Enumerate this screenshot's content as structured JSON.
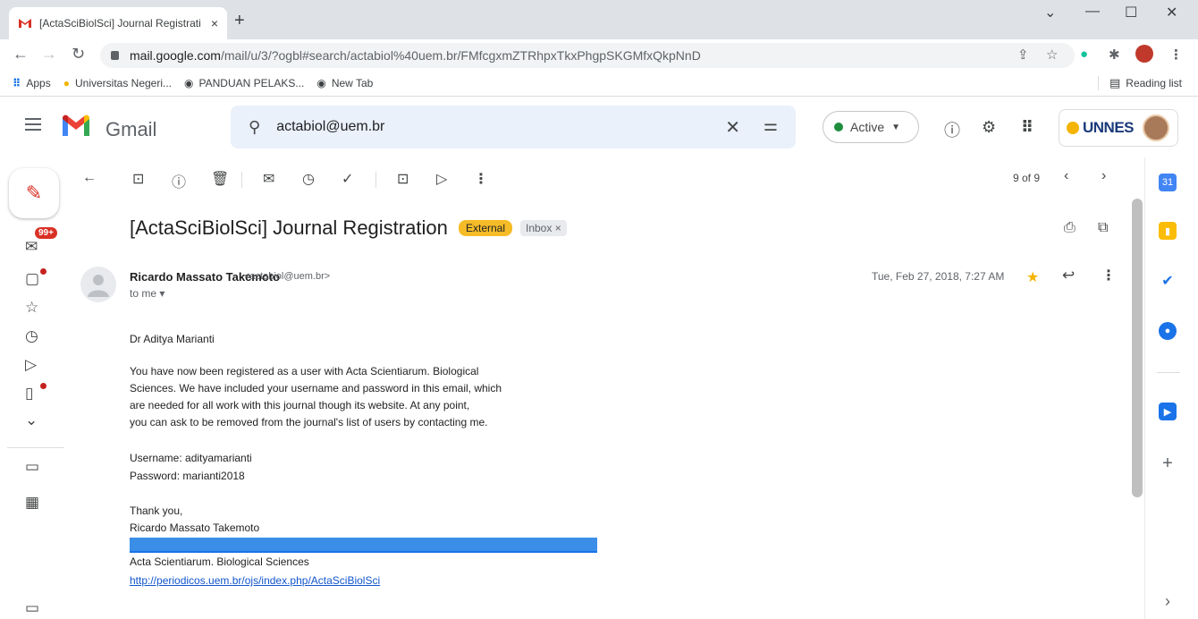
{
  "browser": {
    "tab_title": "[ActaSciBiolSci] Journal Registrati",
    "tab_close": "×",
    "new_tab": "+",
    "url_host": "mail.google.com",
    "url_rest": "/mail/u/3/?ogbl#search/actabiol%40uem.br/FMfcgxmZTRhpxTkxPhgpSKGMfxQkpNnD",
    "bookmarks": [
      {
        "label": "Apps"
      },
      {
        "label": "Universitas Negeri..."
      },
      {
        "label": "PANDUAN PELAKS..."
      },
      {
        "label": "New Tab"
      }
    ],
    "reading_list": "Reading list"
  },
  "gmail": {
    "app_name": "Gmail",
    "search_value": "actabiol@uem.br",
    "status_label": "Active",
    "account_logo_text": "UNNES",
    "unread_badge": "99+",
    "pager": "9 of 9"
  },
  "message": {
    "subject": "[ActaSciBiolSci] Journal Registration",
    "label_external": "External",
    "label_inbox": "Inbox ×",
    "sender_name": "Ricardo Massato Takemoto",
    "sender_email": "<actabiol@uem.br>",
    "to": "to me ▾",
    "date": "Tue, Feb 27, 2018, 7:27 AM",
    "greeting": "Dr Aditya Marianti",
    "para_line1": "You have now been registered as a user with Acta Scientiarum. Biological",
    "para_line2": "Sciences. We have included your username and password in this email, which",
    "para_line3": "are needed for all work with this journal though its website. At any point,",
    "para_line4": "you can ask to be removed from the journal's list of users by contacting me.",
    "username": "Username: adityamarianti",
    "password": "Password: marianti2018",
    "thanks": "Thank you,",
    "signature_name": "Ricardo Massato Takemoto",
    "signature_org": "Acta Scientiarum. Biological Sciences",
    "signature_link": "http://periodicos.uem.br/ojs/index.php/ActaSciBiolSci"
  },
  "colors": {
    "gmail_red": "#d93025",
    "active_green": "#1e8e3e",
    "external_tag": "#f6bc27",
    "link": "#1155cc",
    "selection": "#3b8ee8"
  }
}
